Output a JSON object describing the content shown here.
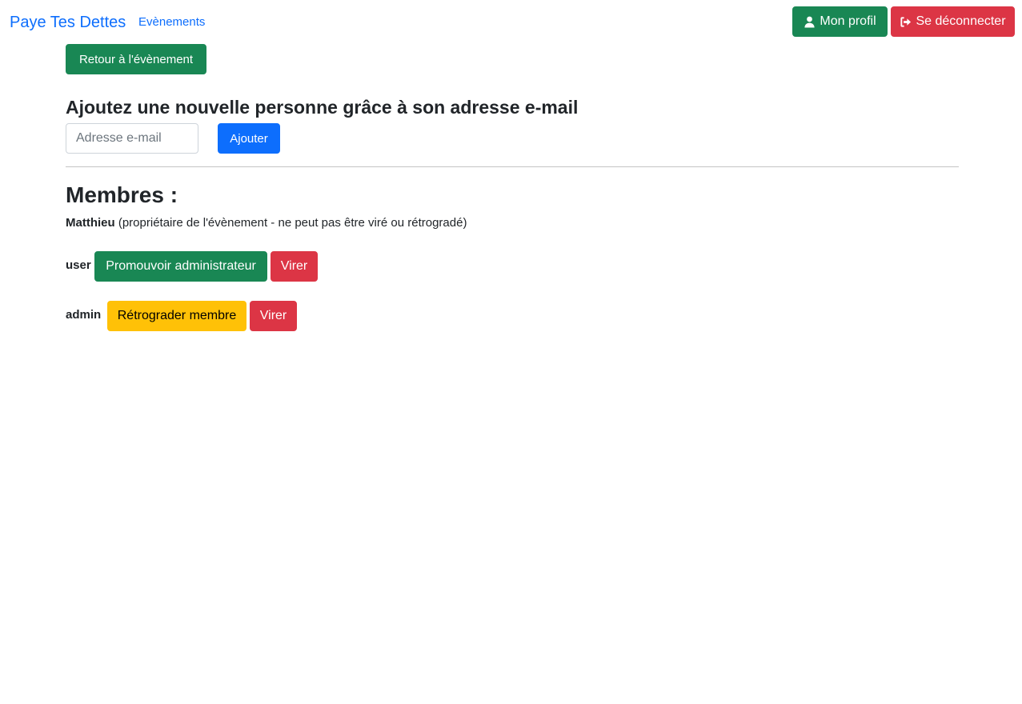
{
  "navbar": {
    "brand": "Paye Tes Dettes",
    "events_link": "Evènements",
    "profile_button": "Mon profil",
    "logout_button": "Se déconnecter"
  },
  "back_button": "Retour à l'évènement",
  "add_member": {
    "heading": "Ajoutez une nouvelle personne grâce à son adresse e-mail",
    "email_placeholder": "Adresse e-mail",
    "email_value": "",
    "submit_button": "Ajouter"
  },
  "members": {
    "title": "Membres :",
    "owner": {
      "name": "Matthieu",
      "note": "(propriétaire de l'évènement - ne peut pas être viré ou rétrogradé)"
    },
    "list": [
      {
        "name": "user",
        "role_action": "Promouvoir administrateur",
        "kick_action": "Virer"
      },
      {
        "name": "admin",
        "role_action": "Rétrograder membre",
        "kick_action": "Virer"
      }
    ]
  },
  "colors": {
    "primary": "#0d6efd",
    "success": "#198754",
    "danger": "#dc3545",
    "warning": "#ffc107",
    "text": "#212529"
  },
  "icons": {
    "profile": "user-icon",
    "logout": "sign-out-icon"
  }
}
